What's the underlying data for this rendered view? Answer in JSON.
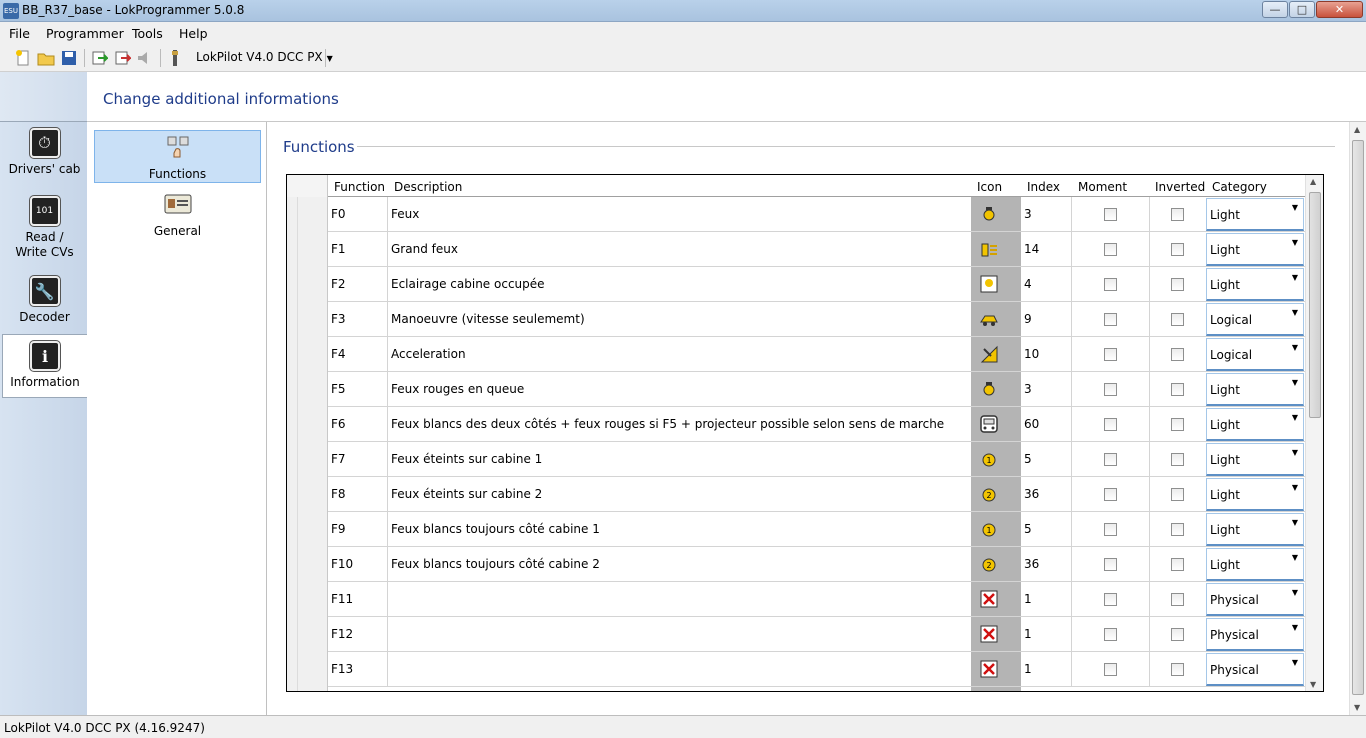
{
  "window": {
    "title": "BB_R37_base - LokProgrammer 5.0.8",
    "app_icon": "ESU"
  },
  "menu": [
    "File",
    "Programmer",
    "Tools",
    "Help"
  ],
  "toolbar": {
    "decoder": "LokPilot V4.0 DCC PX"
  },
  "sidebar": {
    "items": [
      {
        "label": "Drivers' cab",
        "icon": "speedometer-icon"
      },
      {
        "label": "Read / Write CVs",
        "icon": "binary-icon"
      },
      {
        "label": "Decoder",
        "icon": "wrench-icon"
      },
      {
        "label": "Information",
        "icon": "info-icon"
      }
    ],
    "active": "Information"
  },
  "header": {
    "title": "Change additional informations"
  },
  "subnav": {
    "items": [
      {
        "label": "Functions"
      },
      {
        "label": "General"
      }
    ],
    "selected": "Functions"
  },
  "section": {
    "title": "Functions"
  },
  "table": {
    "columns": [
      "Function",
      "Description",
      "Icon",
      "Index",
      "Moment",
      "Inverted",
      "Category"
    ],
    "rows": [
      {
        "function": "F0",
        "description": "Feux",
        "icon": "headlight-icon",
        "index": "3",
        "moment": false,
        "inverted": false,
        "category": "Light"
      },
      {
        "function": "F1",
        "description": "Grand feux",
        "icon": "high-beam-icon",
        "index": "14",
        "moment": false,
        "inverted": false,
        "category": "Light"
      },
      {
        "function": "F2",
        "description": "Eclairage cabine occupée",
        "icon": "cab-light-icon",
        "index": "4",
        "moment": false,
        "inverted": false,
        "category": "Light"
      },
      {
        "function": "F3",
        "description": "Manoeuvre (vitesse seulememt)",
        "icon": "shunting-icon",
        "index": "9",
        "moment": false,
        "inverted": false,
        "category": "Logical"
      },
      {
        "function": "F4",
        "description": "Acceleration",
        "icon": "acceleration-icon",
        "index": "10",
        "moment": false,
        "inverted": false,
        "category": "Logical"
      },
      {
        "function": "F5",
        "description": "Feux rouges en queue",
        "icon": "headlight-icon",
        "index": "3",
        "moment": false,
        "inverted": false,
        "category": "Light"
      },
      {
        "function": "F6",
        "description": "Feux blancs des deux côtés + feux rouges si F5 + projecteur possible selon sens de marche",
        "icon": "loco-front-icon",
        "index": "60",
        "moment": false,
        "inverted": false,
        "category": "Light"
      },
      {
        "function": "F7",
        "description": "Feux éteints sur cabine 1",
        "icon": "cab1-light-icon",
        "index": "5",
        "moment": false,
        "inverted": false,
        "category": "Light"
      },
      {
        "function": "F8",
        "description": "Feux éteints sur cabine 2",
        "icon": "cab2-light-icon",
        "index": "36",
        "moment": false,
        "inverted": false,
        "category": "Light"
      },
      {
        "function": "F9",
        "description": "Feux blancs toujours côté cabine 1",
        "icon": "cab1-light-icon",
        "index": "5",
        "moment": false,
        "inverted": false,
        "category": "Light"
      },
      {
        "function": "F10",
        "description": "Feux blancs toujours côté cabine 2",
        "icon": "cab2-light-icon",
        "index": "36",
        "moment": false,
        "inverted": false,
        "category": "Light"
      },
      {
        "function": "F11",
        "description": "",
        "icon": "none-icon",
        "index": "1",
        "moment": false,
        "inverted": false,
        "category": "Physical"
      },
      {
        "function": "F12",
        "description": "",
        "icon": "none-icon",
        "index": "1",
        "moment": false,
        "inverted": false,
        "category": "Physical"
      },
      {
        "function": "F13",
        "description": "",
        "icon": "none-icon",
        "index": "1",
        "moment": false,
        "inverted": false,
        "category": "Physical"
      }
    ]
  },
  "status": {
    "text": "LokPilot V4.0 DCC PX (4.16.9247)"
  },
  "colors": {
    "accent_title": "#1f3c8a",
    "icon_column": "#b4b4b4",
    "selection": "#c9e0f7",
    "light_yellow": "#f2c400",
    "none_red": "#d01010"
  }
}
